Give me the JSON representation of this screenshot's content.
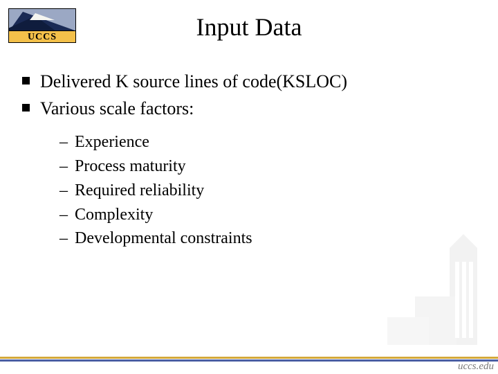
{
  "logo": {
    "text": "UCCS"
  },
  "title": "Input Data",
  "bullets": [
    {
      "text": "Delivered K source  lines of code(KSLOC)"
    },
    {
      "text": "Various scale factors:"
    }
  ],
  "subbullets": [
    {
      "text": "Experience"
    },
    {
      "text": "Process maturity"
    },
    {
      "text": "Required reliability"
    },
    {
      "text": "Complexity"
    },
    {
      "text": "Developmental constraints"
    }
  ],
  "footer": {
    "url": "uccs.edu"
  }
}
